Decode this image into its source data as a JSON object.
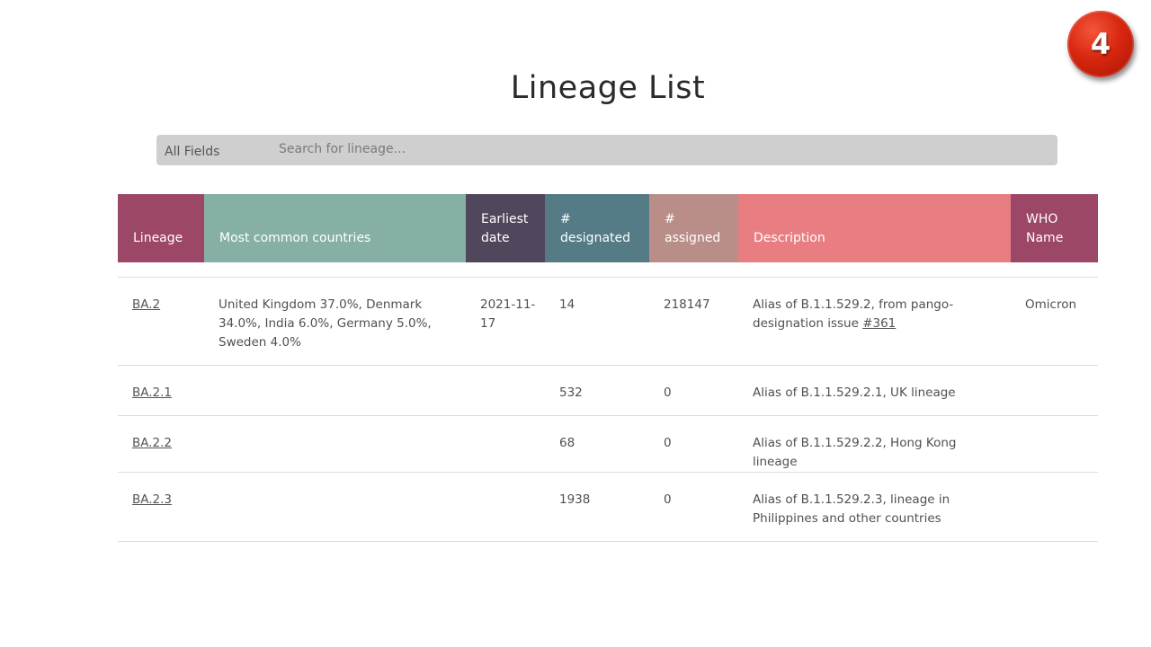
{
  "step_number": "4",
  "page_title": "Lineage List",
  "search": {
    "field_label": "All Fields",
    "placeholder": "Search for lineage..."
  },
  "colors": {
    "lineage": "#9c4668",
    "countries": "#86b0a5",
    "earliest": "#51475c",
    "designated": "#547b86",
    "assigned": "#b98e89",
    "description": "#e97e82",
    "who": "#9c4668"
  },
  "table": {
    "headers": {
      "lineage": "Lineage",
      "countries": "Most common countries",
      "earliest_1": "Earliest",
      "earliest_2": "date",
      "designated_1": "#",
      "designated_2": "designated",
      "assigned_1": "#",
      "assigned_2": "assigned",
      "description": "Description",
      "who_1": "WHO",
      "who_2": "Name"
    },
    "rows": [
      {
        "lineage": "BA.2",
        "countries": "United Kingdom 37.0%, Denmark 34.0%, India 6.0%, Germany 5.0%, Sweden 4.0%",
        "earliest": "2021-11-17",
        "designated": "14",
        "assigned": "218147",
        "description": "Alias of B.1.1.529.2, from pango-designation issue ",
        "description_link": "#361",
        "who": "Omicron"
      },
      {
        "lineage": "BA.2.1",
        "countries": "",
        "earliest": "",
        "designated": "532",
        "assigned": "0",
        "description": "Alias of B.1.1.529.2.1, UK lineage",
        "description_link": "",
        "who": ""
      },
      {
        "lineage": "BA.2.2",
        "countries": "",
        "earliest": "",
        "designated": "68",
        "assigned": "0",
        "description": "Alias of B.1.1.529.2.2, Hong Kong lineage",
        "description_link": "",
        "who": ""
      },
      {
        "lineage": "BA.2.3",
        "countries": "",
        "earliest": "",
        "designated": "1938",
        "assigned": "0",
        "description": "Alias of B.1.1.529.2.3, lineage in Philippines and other countries",
        "description_link": "",
        "who": ""
      }
    ]
  }
}
